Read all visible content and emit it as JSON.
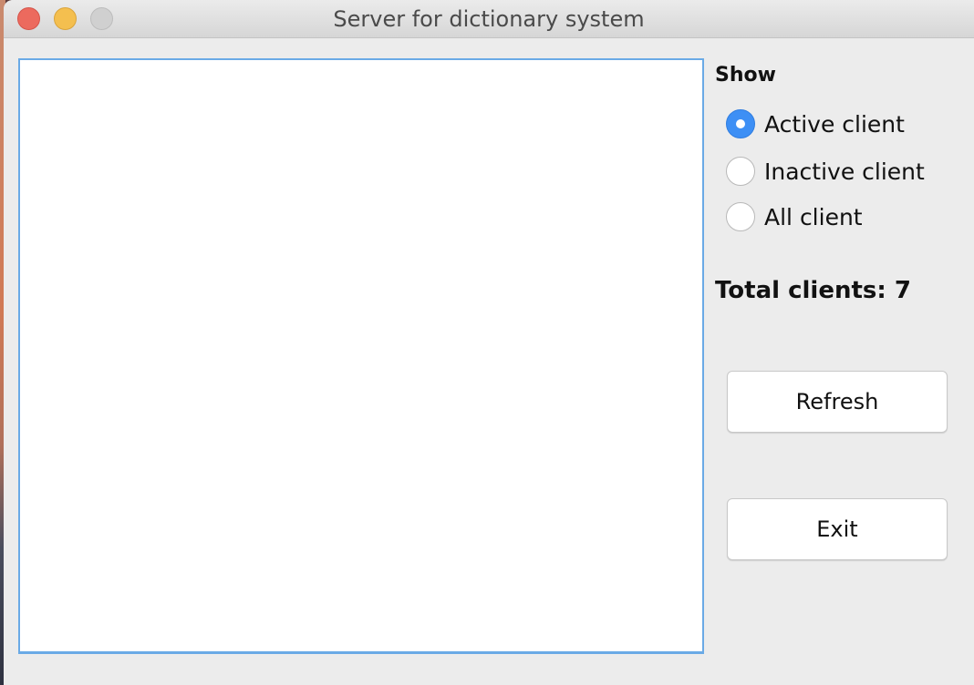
{
  "window": {
    "title": "Server for dictionary system"
  },
  "filter": {
    "heading": "Show",
    "options": [
      {
        "label": "Active client",
        "selected": true
      },
      {
        "label": "Inactive client",
        "selected": false
      },
      {
        "label": "All client",
        "selected": false
      }
    ]
  },
  "stats": {
    "total_clients_text": "Total clients: 7"
  },
  "actions": {
    "refresh_label": "Refresh",
    "exit_label": "Exit"
  },
  "colors": {
    "accent": "#3d8ff5",
    "list_border": "#6aaae6",
    "close": "#ec6a5e",
    "minimize": "#f4bf4f",
    "zoom_inactive": "#d0d0d0"
  }
}
